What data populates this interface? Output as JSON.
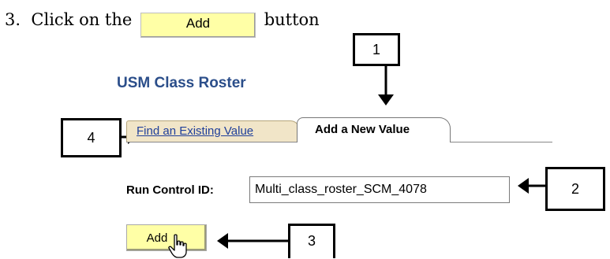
{
  "instruction": {
    "step": "3.",
    "prefix": "Click on the",
    "button_label": "Add",
    "suffix": "button"
  },
  "panel": {
    "title": "USM Class Roster",
    "tabs": [
      {
        "label": "Find an Existing Value"
      },
      {
        "label": "Add a New Value"
      }
    ],
    "run_control": {
      "label": "Run Control ID:",
      "value": "Multi_class_roster_SCM_4078"
    },
    "add_button_label": "Add"
  },
  "callouts": [
    "1",
    "2",
    "3",
    "4"
  ],
  "icons": {
    "cursor": "hand-pointer-icon"
  },
  "colors": {
    "button_fill": "#ffffa6",
    "title_blue": "#2b4e8a",
    "link_blue": "#1f3f9a",
    "tab_inactive": "#f1e5c8"
  }
}
